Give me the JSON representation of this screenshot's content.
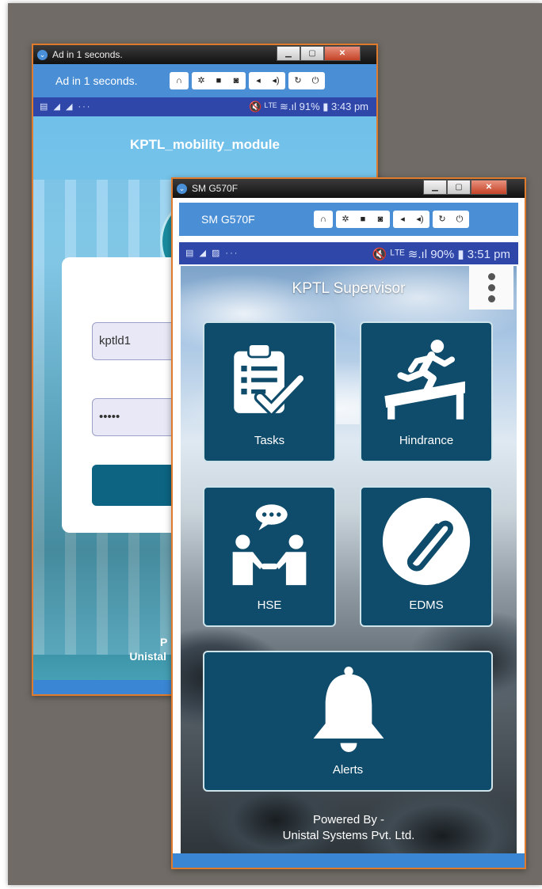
{
  "back_window": {
    "title": "Ad in 1 seconds.",
    "toolbar_title": "Ad in 1 seconds.",
    "status": {
      "left_icons": "▤ ◢ ◢ ···",
      "right": "🔇 ᴸᵀᴱ ≋.ıl 91% ▮ 3:43 pm"
    },
    "app_title": "KPTL_mobility_module",
    "username_value": "kptld1",
    "password_value": "•••••",
    "footer_line1": "P",
    "footer_line2": "Unistal"
  },
  "front_window": {
    "title": "SM G570F",
    "toolbar_title": "SM G570F",
    "status": {
      "left_icons": "▤ ◢ ▨ ···",
      "right": "🔇 ᴸᵀᴱ ≋.ıl 90% ▮ 3:51 pm"
    },
    "app_title": "KPTL Supervisor",
    "tiles": [
      {
        "label": "Tasks",
        "icon": "clipboard-check-icon"
      },
      {
        "label": "Hindrance",
        "icon": "runner-hurdle-icon"
      },
      {
        "label": "HSE",
        "icon": "people-chat-icon"
      },
      {
        "label": "EDMS",
        "icon": "paperclip-icon"
      },
      {
        "label": "Alerts",
        "icon": "bell-icon"
      }
    ],
    "powered_line1": "Powered By -",
    "powered_line2": "Unistal Systems Pvt. Ltd."
  },
  "toolbar_icons": [
    "headphones-icon",
    "gear-icon",
    "video-icon",
    "camera-icon",
    "volume-down-icon",
    "volume-up-icon",
    "refresh-icon",
    "power-icon"
  ],
  "colors": {
    "toolbar": "#4a8fd6",
    "statusbar": "#2e47a8",
    "tile": "#0f4c6b",
    "window_border": "#e07a2c",
    "backdrop": "#706b66"
  }
}
